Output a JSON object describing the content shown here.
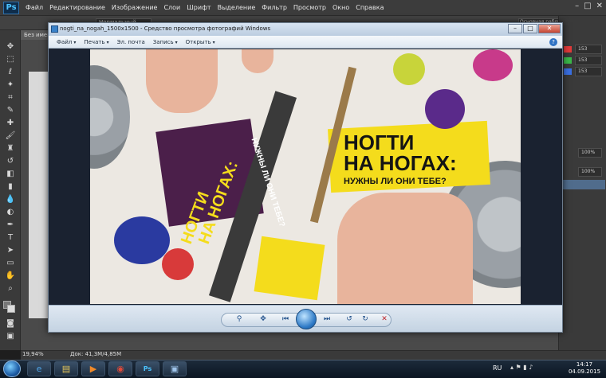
{
  "photoshop": {
    "logo": "Ps",
    "menu": [
      "Файл",
      "Редактирование",
      "Изображение",
      "Слои",
      "Шрифт",
      "Выделение",
      "Фильтр",
      "Просмотр",
      "Окно",
      "Справка"
    ],
    "doc_tab": "Без имени",
    "zoom": "19,94%",
    "doc_size": "Док: 41,3M/4,85M",
    "options": {
      "style_value": "Нормальный",
      "workspace": "Основная рабочая среда"
    },
    "panel_values": [
      "153",
      "153",
      "153"
    ],
    "opacity_a": "100%",
    "opacity_b": "100%"
  },
  "viewer": {
    "title": "nogti_na_nogah_1500x1500 - Средство просмотра фотографий Windows",
    "menu": [
      "Файл",
      "Печать",
      "Эл. почта",
      "Запись",
      "Открыть"
    ],
    "help": "?",
    "photo": {
      "headline_right_1": "НОГТИ",
      "headline_right_2": "НА НОГАХ:",
      "sub_right": "НУЖНЫ ЛИ ОНИ ТЕБЕ?",
      "headline_left_1": "НОГТИ",
      "headline_left_2": "НА НОГАХ:",
      "sub_left": "НУЖНЫ ЛИ ОНИ ТЕБЕ?"
    }
  },
  "taskbar": {
    "lang": "RU",
    "time": "14:17",
    "date": "04.09.2015"
  }
}
